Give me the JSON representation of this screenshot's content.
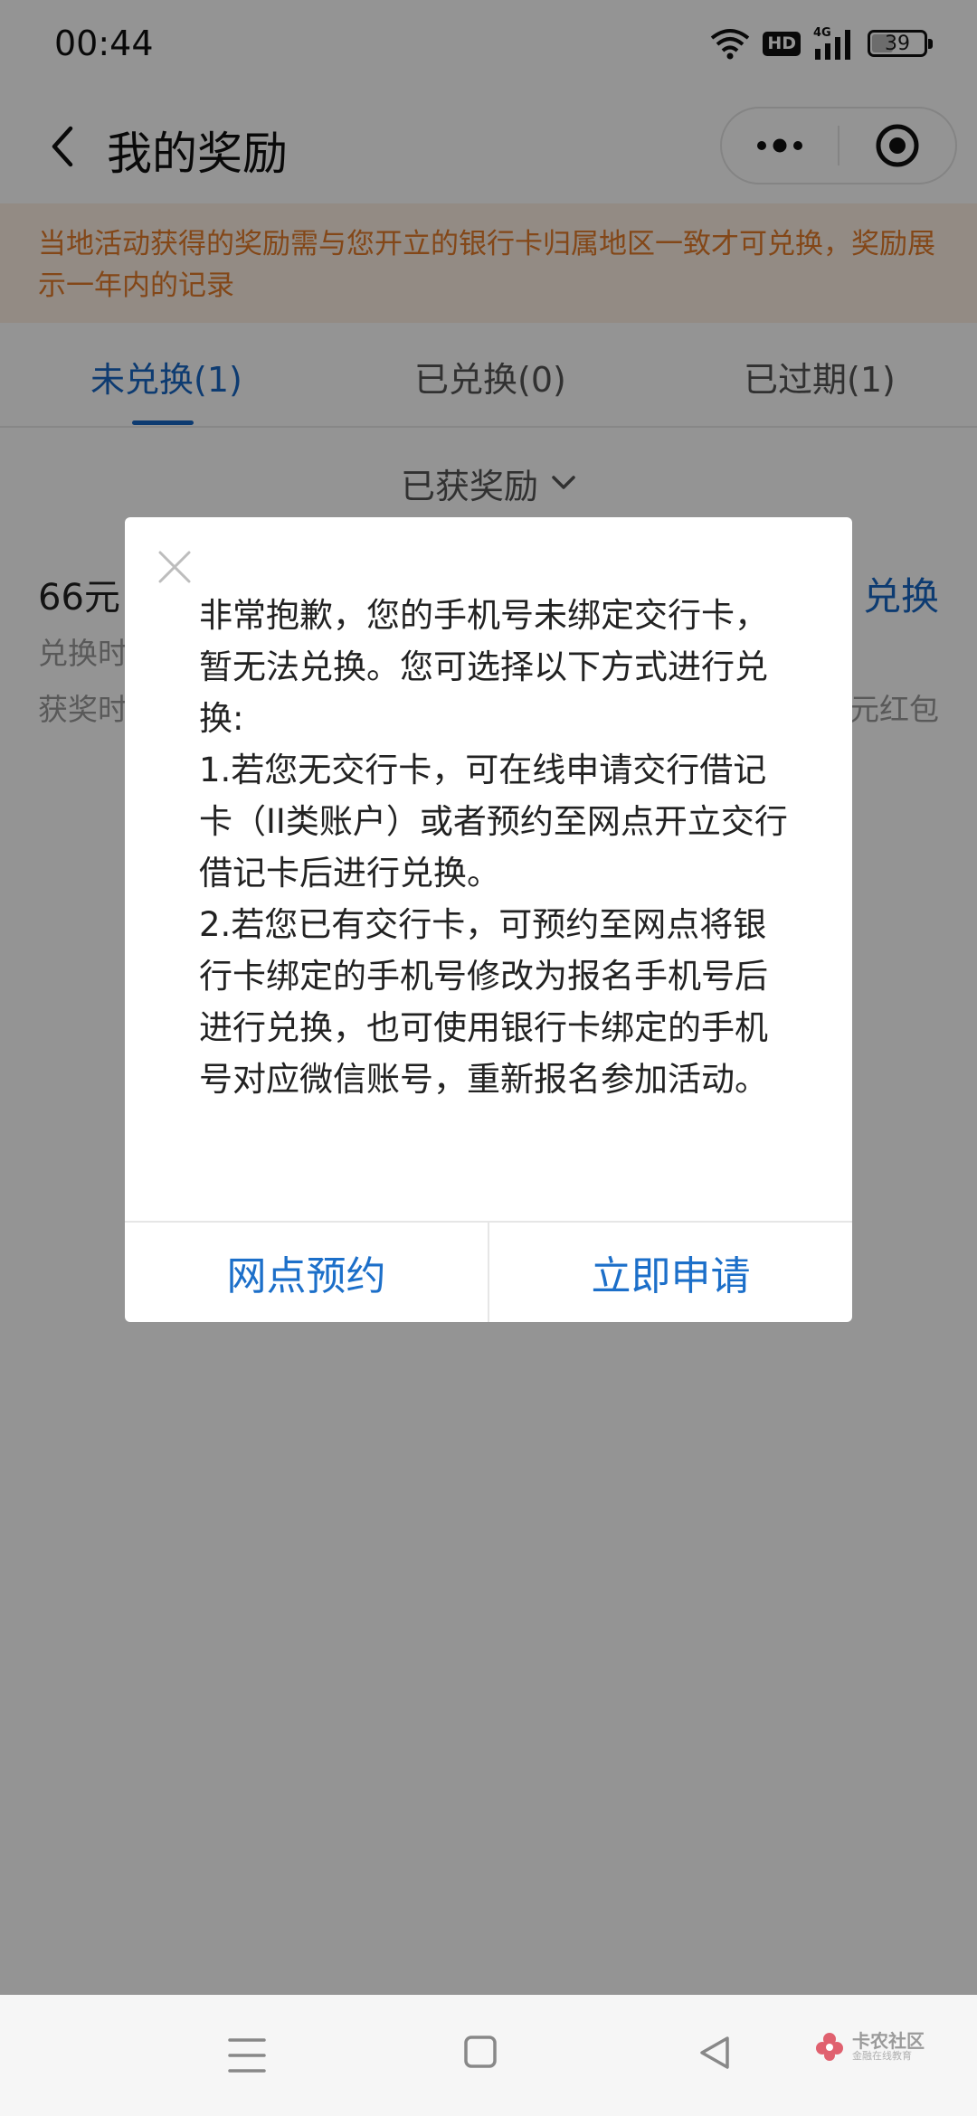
{
  "status_bar": {
    "time": "00:44",
    "hd_label": "HD",
    "network_label": "4G",
    "battery_level": "39",
    "battery_fraction": 0.39
  },
  "header": {
    "title": "我的奖励",
    "icons": [
      "back-icon",
      "more-icon",
      "close-target-icon"
    ]
  },
  "notice": {
    "text": "当地活动获得的奖励需与您开立的银行卡归属地区一致才可兑换，奖励展示一年内的记录"
  },
  "tabs": [
    {
      "label": "未兑换(1)",
      "active": true
    },
    {
      "label": "已兑换(0)",
      "active": false
    },
    {
      "label": "已过期(1)",
      "active": false
    }
  ],
  "filter": {
    "label": "已获奖励"
  },
  "reward": {
    "title": "66元!",
    "action": "兑换",
    "line1": "兑换时",
    "line2": "获奖时",
    "tag": "元红包"
  },
  "dialog": {
    "message": "非常抱歉，您的手机号未绑定交行卡，暂无法兑换。您可选择以下方式进行兑换:\n1.若您无交行卡，可在线申请交行借记卡（II类账户）或者预约至网点开立交行借记卡后进行兑换。\n2.若您已有交行卡，可预约至网点将银行卡绑定的手机号修改为报名手机号后进行兑换，也可使用银行卡绑定的手机号对应微信账号，重新报名参加活动。",
    "left_button": "网点预约",
    "right_button": "立即申请"
  },
  "watermark": {
    "main": "卡农社区",
    "sub": "金融在线教育"
  },
  "colors": {
    "primary_blue": "#1766c3",
    "notice_orange": "#e27b2a",
    "notice_bg": "#fdf0e4"
  }
}
